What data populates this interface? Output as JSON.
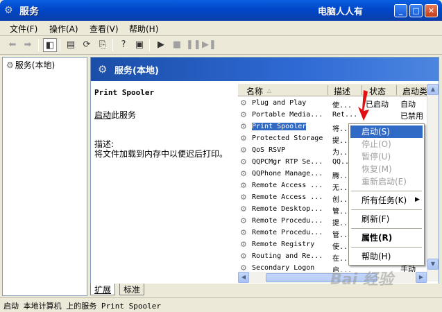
{
  "window": {
    "title": "服务",
    "watermark_top": "电脑人人有"
  },
  "menubar": {
    "items": [
      "文件(F)",
      "操作(A)",
      "查看(V)",
      "帮助(H)"
    ]
  },
  "tree": {
    "root": "服务(本地)"
  },
  "header": {
    "title": "服务(本地)"
  },
  "description": {
    "service_name": "Print Spooler",
    "start_link": "启动",
    "start_suffix": "此服务",
    "desc_label": "描述:",
    "desc_text": "将文件加载到内存中以便迟后打印。"
  },
  "list": {
    "columns": {
      "name": "名称",
      "desc": "描述",
      "status": "状态",
      "startup": "启动类"
    },
    "rows": [
      {
        "name": "Plug and Play",
        "desc": "使...",
        "status": "已启动",
        "startup": "自动"
      },
      {
        "name": "Portable Media...",
        "desc": "Ret...",
        "status": "",
        "startup": "已禁用"
      },
      {
        "name": "Print Spooler",
        "desc": "将...",
        "status": "",
        "startup": ""
      },
      {
        "name": "Protected Storage",
        "desc": "提...",
        "status": "",
        "startup": ""
      },
      {
        "name": "QoS RSVP",
        "desc": "为...",
        "status": "",
        "startup": ""
      },
      {
        "name": "QQPCMgr RTP Se...",
        "desc": "QQ...",
        "status": "",
        "startup": ""
      },
      {
        "name": "QQPhone Manage...",
        "desc": "腾...",
        "status": "",
        "startup": ""
      },
      {
        "name": "Remote Access ...",
        "desc": "无...",
        "status": "",
        "startup": ""
      },
      {
        "name": "Remote Access ...",
        "desc": "创...",
        "status": "",
        "startup": ""
      },
      {
        "name": "Remote Desktop...",
        "desc": "管...",
        "status": "",
        "startup": ""
      },
      {
        "name": "Remote Procedu...",
        "desc": "提...",
        "status": "",
        "startup": ""
      },
      {
        "name": "Remote Procedu...",
        "desc": "管...",
        "status": "",
        "startup": ""
      },
      {
        "name": "Remote Registry",
        "desc": "使...",
        "status": "",
        "startup": ""
      },
      {
        "name": "Routing and Re...",
        "desc": "在...",
        "status": "",
        "startup": ""
      },
      {
        "name": "Secondary Logon",
        "desc": "启...",
        "status": "",
        "startup": "手动"
      }
    ]
  },
  "tabs": {
    "extended": "扩展",
    "standard": "标准"
  },
  "context_menu": {
    "start": "启动(S)",
    "stop": "停止(O)",
    "pause": "暂停(U)",
    "resume": "恢复(M)",
    "restart": "重新启动(E)",
    "all_tasks": "所有任务(K)",
    "refresh": "刷新(F)",
    "properties": "属性(R)",
    "help": "帮助(H)"
  },
  "statusbar": {
    "text": "启动 本地计算机 上的服务 Print Spooler"
  },
  "watermark_bottom": "Bai 经验",
  "colors": {
    "title_bar": "#0a5fe0",
    "selection": "#316ac5",
    "arrow": "#e01010"
  }
}
